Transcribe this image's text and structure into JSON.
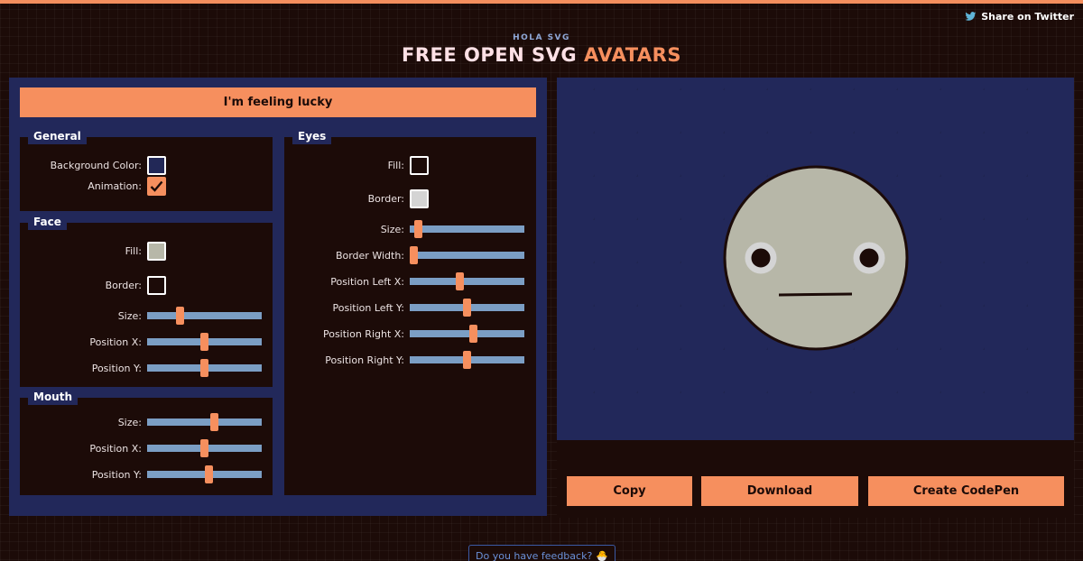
{
  "header": {
    "share_label": "Share on Twitter",
    "brand": "HOLA SVG",
    "title_white": "FREE OPEN SVG ",
    "title_orange": "AVATARS"
  },
  "controls": {
    "lucky_label": "I'm feeling lucky",
    "general": {
      "legend": "General",
      "background_color_label": "Background Color:",
      "background_color": "#222857",
      "animation_label": "Animation:",
      "animation_checked": true
    },
    "face": {
      "legend": "Face",
      "fill_label": "Fill:",
      "fill_color": "#b7b7a8",
      "border_label": "Border:",
      "border_color": "#1c0b08",
      "size_label": "Size:",
      "size_value": 0.27,
      "position_x_label": "Position X:",
      "position_x_value": 0.5,
      "position_y_label": "Position Y:",
      "position_y_value": 0.5
    },
    "mouth": {
      "legend": "Mouth",
      "size_label": "Size:",
      "size_value": 0.59,
      "position_x_label": "Position X:",
      "position_x_value": 0.5,
      "position_y_label": "Position Y:",
      "position_y_value": 0.54
    },
    "eyes": {
      "legend": "Eyes",
      "fill_label": "Fill:",
      "fill_color": "#1c0b08",
      "border_label": "Border:",
      "border_color": "#d4d4d4",
      "size_label": "Size:",
      "size_value": 0.04,
      "border_width_label": "Border Width:",
      "border_width_value": 0.0,
      "position_left_x_label": "Position Left X:",
      "position_left_x_value": 0.43,
      "position_left_y_label": "Position Left Y:",
      "position_left_y_value": 0.5,
      "position_right_x_label": "Position Right X:",
      "position_right_x_value": 0.56,
      "position_right_y_label": "Position Right Y:",
      "position_right_y_value": 0.5
    }
  },
  "avatar": {
    "background_color": "#222857",
    "face_color": "#b7b7a8",
    "outline_color": "#1c0b08",
    "eye_ring_color": "#d4d4d4"
  },
  "actions": {
    "copy_label": "Copy",
    "download_label": "Download",
    "codepen_label": "Create CodePen"
  },
  "feedback": {
    "label": "Do you have feedback?",
    "emoji": "🐣"
  },
  "colors": {
    "accent": "#f68f5e",
    "panel": "#22285a",
    "dark": "#1c0b08",
    "slider_track": "#7b9ec4"
  }
}
